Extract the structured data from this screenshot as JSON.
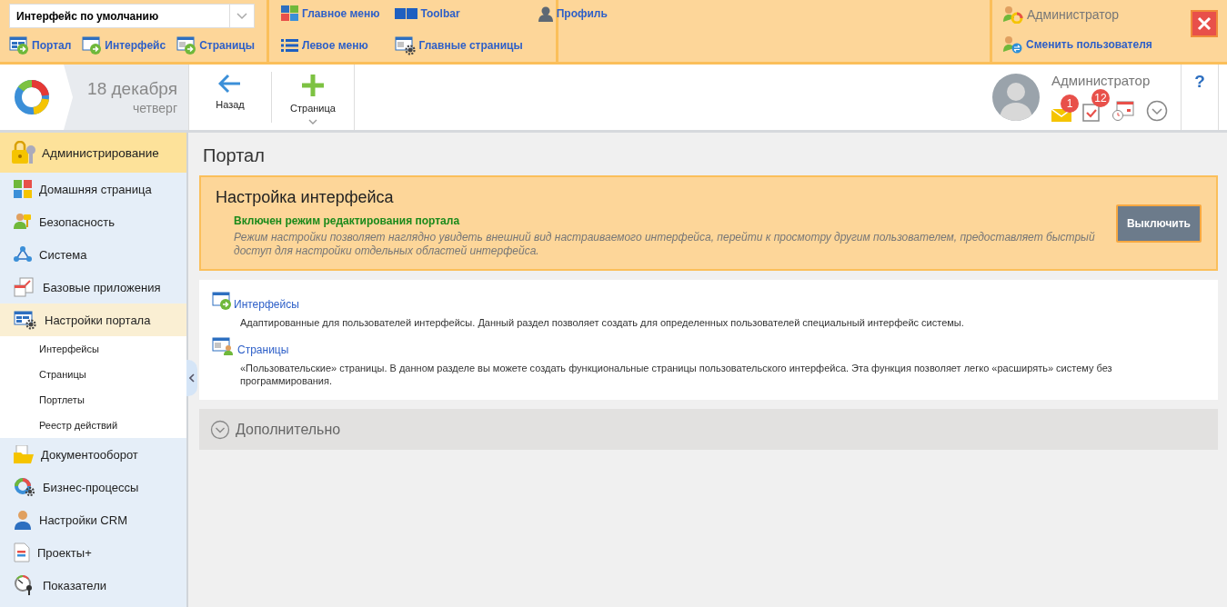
{
  "edit_panel": {
    "interface_select": {
      "value": "Интерфейс по умолчанию"
    },
    "links": [
      {
        "label": "Портал",
        "kind": "portal"
      },
      {
        "label": "Интерфейс",
        "kind": "window"
      },
      {
        "label": "Страницы",
        "kind": "pages"
      }
    ],
    "menu_links": [
      {
        "label": "Главное меню",
        "kind": "tiles"
      },
      {
        "label": "Toolbar",
        "kind": "toolbar"
      },
      {
        "label": "Профиль",
        "kind": "person"
      },
      {
        "label": "Левое меню",
        "kind": "list"
      },
      {
        "label": "Главные страницы",
        "kind": "pages-gear"
      }
    ],
    "user": {
      "name": "Администратор",
      "switch_label": "Сменить пользователя"
    }
  },
  "header": {
    "date": "18 декабря",
    "weekday": "четверг",
    "buttons": [
      {
        "label": "Назад",
        "kind": "back",
        "dropdown": false
      },
      {
        "label": "Страница",
        "kind": "add",
        "dropdown": true
      }
    ],
    "user": {
      "name": "Администратор"
    },
    "notifications": [
      {
        "kind": "mail",
        "count": "1"
      },
      {
        "kind": "tasks",
        "count": "12"
      },
      {
        "kind": "calendar"
      }
    ],
    "help": "?"
  },
  "sidebar": {
    "header": {
      "label": "Администрирование"
    },
    "items": [
      {
        "label": "Домашняя страница",
        "kind": "home",
        "selected": false
      },
      {
        "label": "Безопасность",
        "kind": "security",
        "selected": false
      },
      {
        "label": "Система",
        "kind": "system",
        "selected": false
      },
      {
        "label": "Базовые приложения",
        "kind": "apps",
        "selected": false
      },
      {
        "label": "Настройки портала",
        "kind": "portal-settings",
        "selected": true,
        "expanded": true,
        "children": [
          {
            "label": "Интерфейсы",
            "selected": false
          },
          {
            "label": "Страницы",
            "selected": false
          },
          {
            "label": "Портлеты",
            "selected": false
          },
          {
            "label": "Реестр действий",
            "selected": false
          }
        ]
      },
      {
        "label": "Документооборот",
        "kind": "docs",
        "selected": false
      },
      {
        "label": "Бизнес-процессы",
        "kind": "bp",
        "selected": false
      },
      {
        "label": "Настройки CRM",
        "kind": "crm",
        "selected": false
      },
      {
        "label": "Проекты+",
        "kind": "projects",
        "selected": false
      },
      {
        "label": "Показатели",
        "kind": "kpi",
        "selected": false
      }
    ]
  },
  "page": {
    "title": "Портал",
    "notice": {
      "title": "Настройка интерфейса",
      "status": "Включен режим редактирования портала",
      "description": "Режим настройки позволяет наглядно увидеть внешний вид настраиваемого интерфейса, перейти к просмотру другим пользователем, предоставляет быстрый доступ для настройки отдельных областей интерфейса.",
      "button": "Выключить"
    },
    "sections": [
      {
        "title": "Интерфейсы",
        "kind": "window",
        "description": "Адаптированные для пользователей интерфейсы. Данный раздел позволяет создать для определенных пользователей специальный интерфейс системы."
      },
      {
        "title": "Страницы",
        "kind": "user-page",
        "description": "«Пользовательские» страницы. В данном разделе вы можете создать функциональные страницы пользовательского интерфейса. Эта функция позволяет легко «расширять» систему без программирования."
      }
    ],
    "more": "Дополнительно"
  }
}
